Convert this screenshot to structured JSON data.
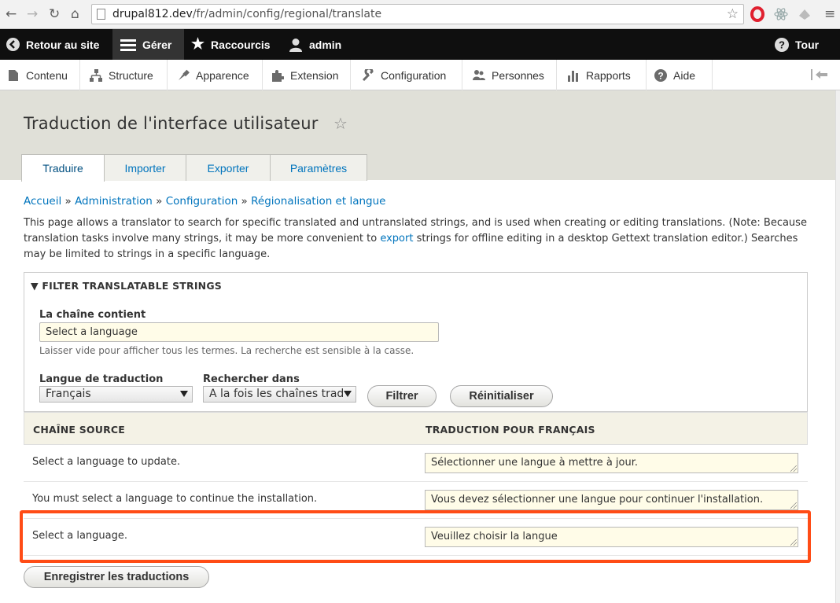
{
  "browser": {
    "url_host": "drupal812.dev",
    "url_path": "/fr/admin/config/regional/translate"
  },
  "toolbar": {
    "back_to_site": "Retour au site",
    "manage": "Gérer",
    "shortcuts": "Raccourcis",
    "user": "admin",
    "tour": "Tour"
  },
  "tray": {
    "items": [
      "Contenu",
      "Structure",
      "Apparence",
      "Extension",
      "Configuration",
      "Personnes",
      "Rapports",
      "Aide"
    ]
  },
  "page": {
    "title": "Traduction de l'interface utilisateur"
  },
  "tabs": [
    "Traduire",
    "Importer",
    "Exporter",
    "Paramètres"
  ],
  "breadcrumb": [
    "Accueil",
    "Administration",
    "Configuration",
    "Régionalisation et langue"
  ],
  "breadcrumb_sep": " » ",
  "description": {
    "before_link": "This page allows a translator to search for specific translated and untranslated strings, and is used when creating or editing translations. (Note: Because translation tasks involve many strings, it may be more convenient to ",
    "link": "export",
    "after_link": " strings for offline editing in a desktop Gettext translation editor.) Searches may be limited to strings in a specific language."
  },
  "filter": {
    "legend": "▼ FILTER TRANSLATABLE STRINGS",
    "contains_label": "La chaîne contient",
    "contains_value": "Select a language",
    "contains_help": "Laisser vide pour afficher tous les termes. La recherche est sensible à la casse.",
    "language_label": "Langue de traduction",
    "language_value": "Français",
    "search_in_label": "Rechercher dans",
    "search_in_value": "A la fois les chaînes trad",
    "filter_button": "Filtrer",
    "reset_button": "Réinitialiser"
  },
  "table": {
    "col_source": "CHAÎNE SOURCE",
    "col_translation": "TRADUCTION POUR FRANÇAIS",
    "rows": [
      {
        "source": "Select a language to update.",
        "translation": "Sélectionner une langue à mettre à jour."
      },
      {
        "source": "You must select a language to continue the installation.",
        "translation": "Vous devez sélectionner une langue pour continuer l'installation."
      },
      {
        "source": "Select a language.",
        "translation": "Veuillez choisir la langue"
      }
    ]
  },
  "save_button": "Enregistrer les traductions",
  "colors": {
    "link": "#0074bd",
    "highlight": "#ff4c16",
    "toolbar": "#0f0f0f"
  }
}
